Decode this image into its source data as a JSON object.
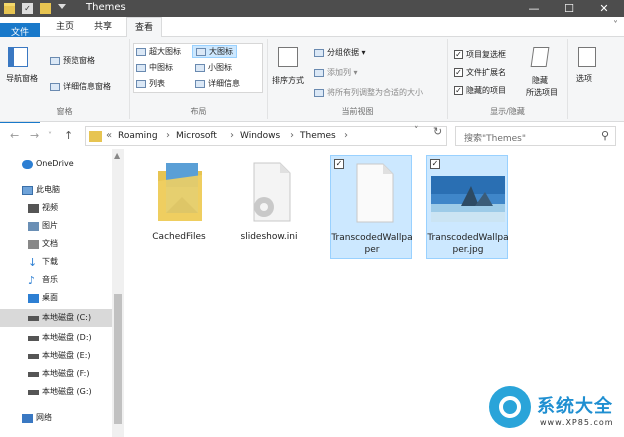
{
  "window": {
    "title": "Themes",
    "controls": {
      "minimize": "—",
      "maximize": "☐",
      "close": "✕"
    }
  },
  "ribbon_tabs": [
    {
      "label": "文件"
    },
    {
      "label": "主页"
    },
    {
      "label": "共享"
    },
    {
      "label": "查看"
    }
  ],
  "ribbon_expand_icon": "˅",
  "ribbon": {
    "panes": {
      "label": "窗格",
      "nav_pane": "导航窗格",
      "preview_pane": "预览窗格",
      "details_pane": "详细信息窗格"
    },
    "layout": {
      "label": "布局",
      "items": [
        "超大图标",
        "大图标",
        "中图标",
        "小图标",
        "列表",
        "详细信息"
      ]
    },
    "current_view": {
      "label": "当前视图",
      "sort_by": "排序方式",
      "group_by": "分组依据",
      "add_column": "添加列",
      "fit_columns": "将所有列调整为合适的大小"
    },
    "show_hide": {
      "label": "显示/隐藏",
      "item_checkboxes": "项目复选框",
      "file_extensions": "文件扩展名",
      "hidden_items": "隐藏的项目",
      "hide_selected_top": "隐藏",
      "hide_selected_bottom": "所选项目",
      "options": "选项"
    }
  },
  "address": {
    "prefix": "«",
    "crumbs": [
      "Roaming",
      "Microsoft",
      "Windows",
      "Themes"
    ],
    "search_placeholder": "搜索\"Themes\""
  },
  "sidebar": {
    "items": [
      {
        "label": "OneDrive",
        "icon": "cloud-icon"
      },
      {
        "label": "此电脑",
        "icon": "computer-icon"
      },
      {
        "label": "视频",
        "icon": "video-icon"
      },
      {
        "label": "图片",
        "icon": "pictures-icon"
      },
      {
        "label": "文档",
        "icon": "documents-icon"
      },
      {
        "label": "下载",
        "icon": "download-icon"
      },
      {
        "label": "音乐",
        "icon": "music-icon"
      },
      {
        "label": "桌面",
        "icon": "desktop-icon"
      },
      {
        "label": "本地磁盘 (C:)",
        "icon": "drive-icon"
      },
      {
        "label": "本地磁盘 (D:)",
        "icon": "drive-icon"
      },
      {
        "label": "本地磁盘 (E:)",
        "icon": "drive-icon"
      },
      {
        "label": "本地磁盘 (F:)",
        "icon": "drive-icon"
      },
      {
        "label": "本地磁盘 (G:)",
        "icon": "drive-icon"
      },
      {
        "label": "网络",
        "icon": "network-icon"
      }
    ]
  },
  "files": [
    {
      "name": "CachedFiles",
      "icon": "folder-icon",
      "selected": false
    },
    {
      "name": "slideshow.ini",
      "icon": "settings-file-icon",
      "selected": false
    },
    {
      "name": "TranscodedWallpaper",
      "icon": "blank-file-icon",
      "selected": true
    },
    {
      "name": "TranscodedWallpaper.jpg",
      "icon": "image-file-icon",
      "selected": true
    }
  ],
  "watermark": {
    "title": "系统大全",
    "url": "www.XP85.com"
  },
  "colors": {
    "accent": "#1979ca",
    "selection": "#cce8ff",
    "folder": "#e7c451"
  }
}
